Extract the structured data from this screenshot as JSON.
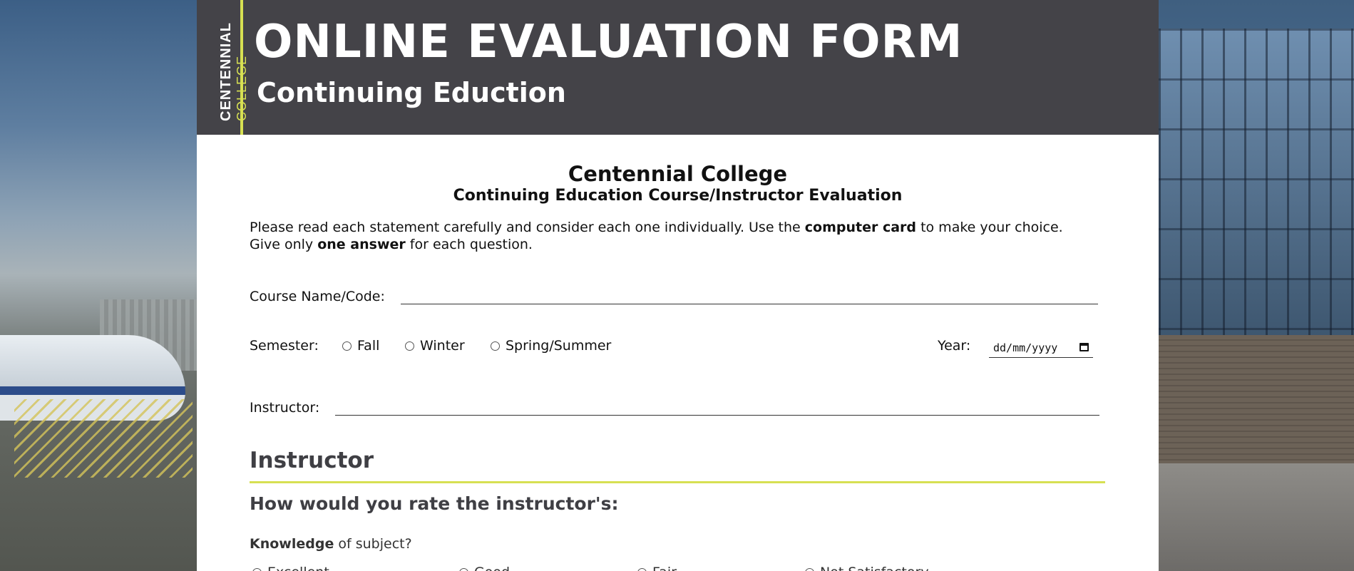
{
  "banner": {
    "logo_line1": "CENTENNIAL",
    "logo_line2": "COLLEGE",
    "title": "ONLINE EVALUATION FORM",
    "subtitle": "Continuing Eduction"
  },
  "form": {
    "heading": "Centennial College",
    "subheading": "Continuing Education Course/Instructor Evaluation",
    "instructions": {
      "part1": "Please read each statement carefully and consider each one individually. Use the ",
      "bold1": "computer card",
      "part2": " to make your choice. Give only ",
      "bold2": "one answer",
      "part3": " for each question."
    },
    "course_label": "Course Name/Code:",
    "course_value": "",
    "semester_label": "Semester:",
    "semester_options": [
      "Fall",
      "Winter",
      "Spring/Summer"
    ],
    "year_label": "Year:",
    "year_placeholder": "dd/mm/yyyy",
    "instructor_label": "Instructor:",
    "instructor_value": ""
  },
  "section": {
    "title": "Instructor",
    "question_heading": "How would you rate the instructor's:",
    "question_bold": "Knowledge",
    "question_rest": " of subject?",
    "answers": [
      "Excellent",
      "Good",
      "Fair",
      "Not Satisfactory"
    ]
  },
  "colors": {
    "banner_bg": "#444348",
    "accent": "#d7e052"
  }
}
